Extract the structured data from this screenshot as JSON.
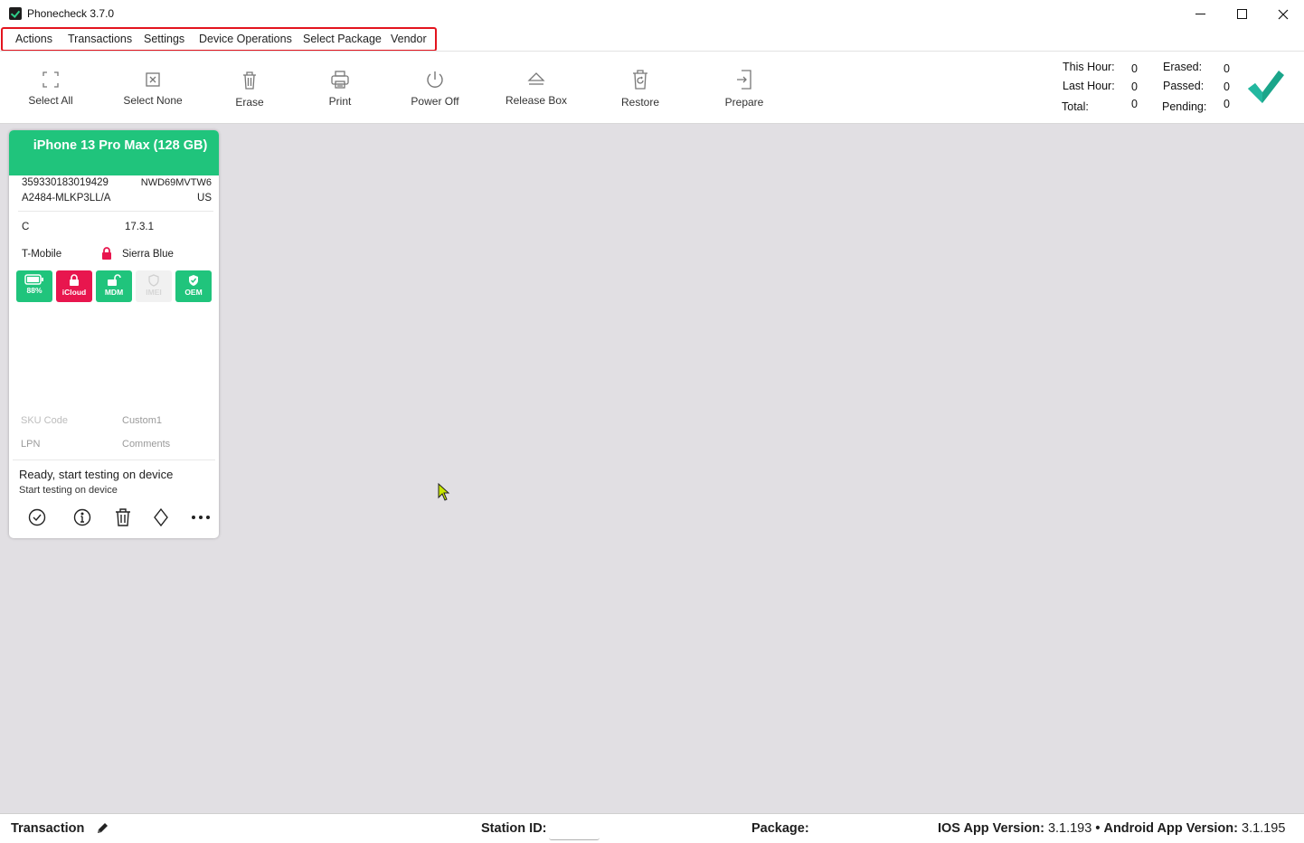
{
  "window": {
    "title": "Phonecheck 3.7.0"
  },
  "menu": [
    "Actions",
    "Transactions",
    "Settings",
    "Device Operations",
    "Select Package",
    "Vendor"
  ],
  "toolbar": {
    "select_all": "Select All",
    "select_none": "Select None",
    "erase": "Erase",
    "print": "Print",
    "power_off": "Power Off",
    "release_box": "Release Box",
    "restore": "Restore",
    "prepare": "Prepare"
  },
  "stats": {
    "this_hour_label": "This Hour:",
    "this_hour": "0",
    "last_hour_label": "Last Hour:",
    "last_hour": "0",
    "total_label": "Total:",
    "total": "0",
    "erased_label": "Erased:",
    "erased": "0",
    "passed_label": "Passed:",
    "passed": "0",
    "pending_label": "Pending:",
    "pending": "0"
  },
  "device": {
    "title": "iPhone 13 Pro Max (128 GB)",
    "imei": "359330183019429",
    "serial": "NWD69MVTW6",
    "model": "A2484-MLKP3LL/A",
    "region": "US",
    "grade": "C",
    "ios_version": "17.3.1",
    "carrier": "T-Mobile",
    "color": "Sierra Blue",
    "badges": {
      "battery": "88%",
      "icloud": "iCloud",
      "mdm": "MDM",
      "imei": "IMEI",
      "oem": "OEM"
    },
    "sku_label": "SKU Code",
    "custom1_label": "Custom1",
    "lpn_label": "LPN",
    "comments_label": "Comments",
    "status_main": "Ready, start testing on device",
    "status_sub": "Start testing on device"
  },
  "statusbar": {
    "transaction": "Transaction",
    "station_id": "Station ID:",
    "package": "Package:",
    "ios_label": "IOS App Version:",
    "ios_version": "3.1.193",
    "separator": "•",
    "android_label": "Android App Version:",
    "android_version": "3.1.195"
  },
  "colors": {
    "accent_green": "#20c47c",
    "icloud_red": "#e8164e",
    "workspace_bg": "#e1dfe3",
    "menu_highlight": "#e3141e"
  }
}
